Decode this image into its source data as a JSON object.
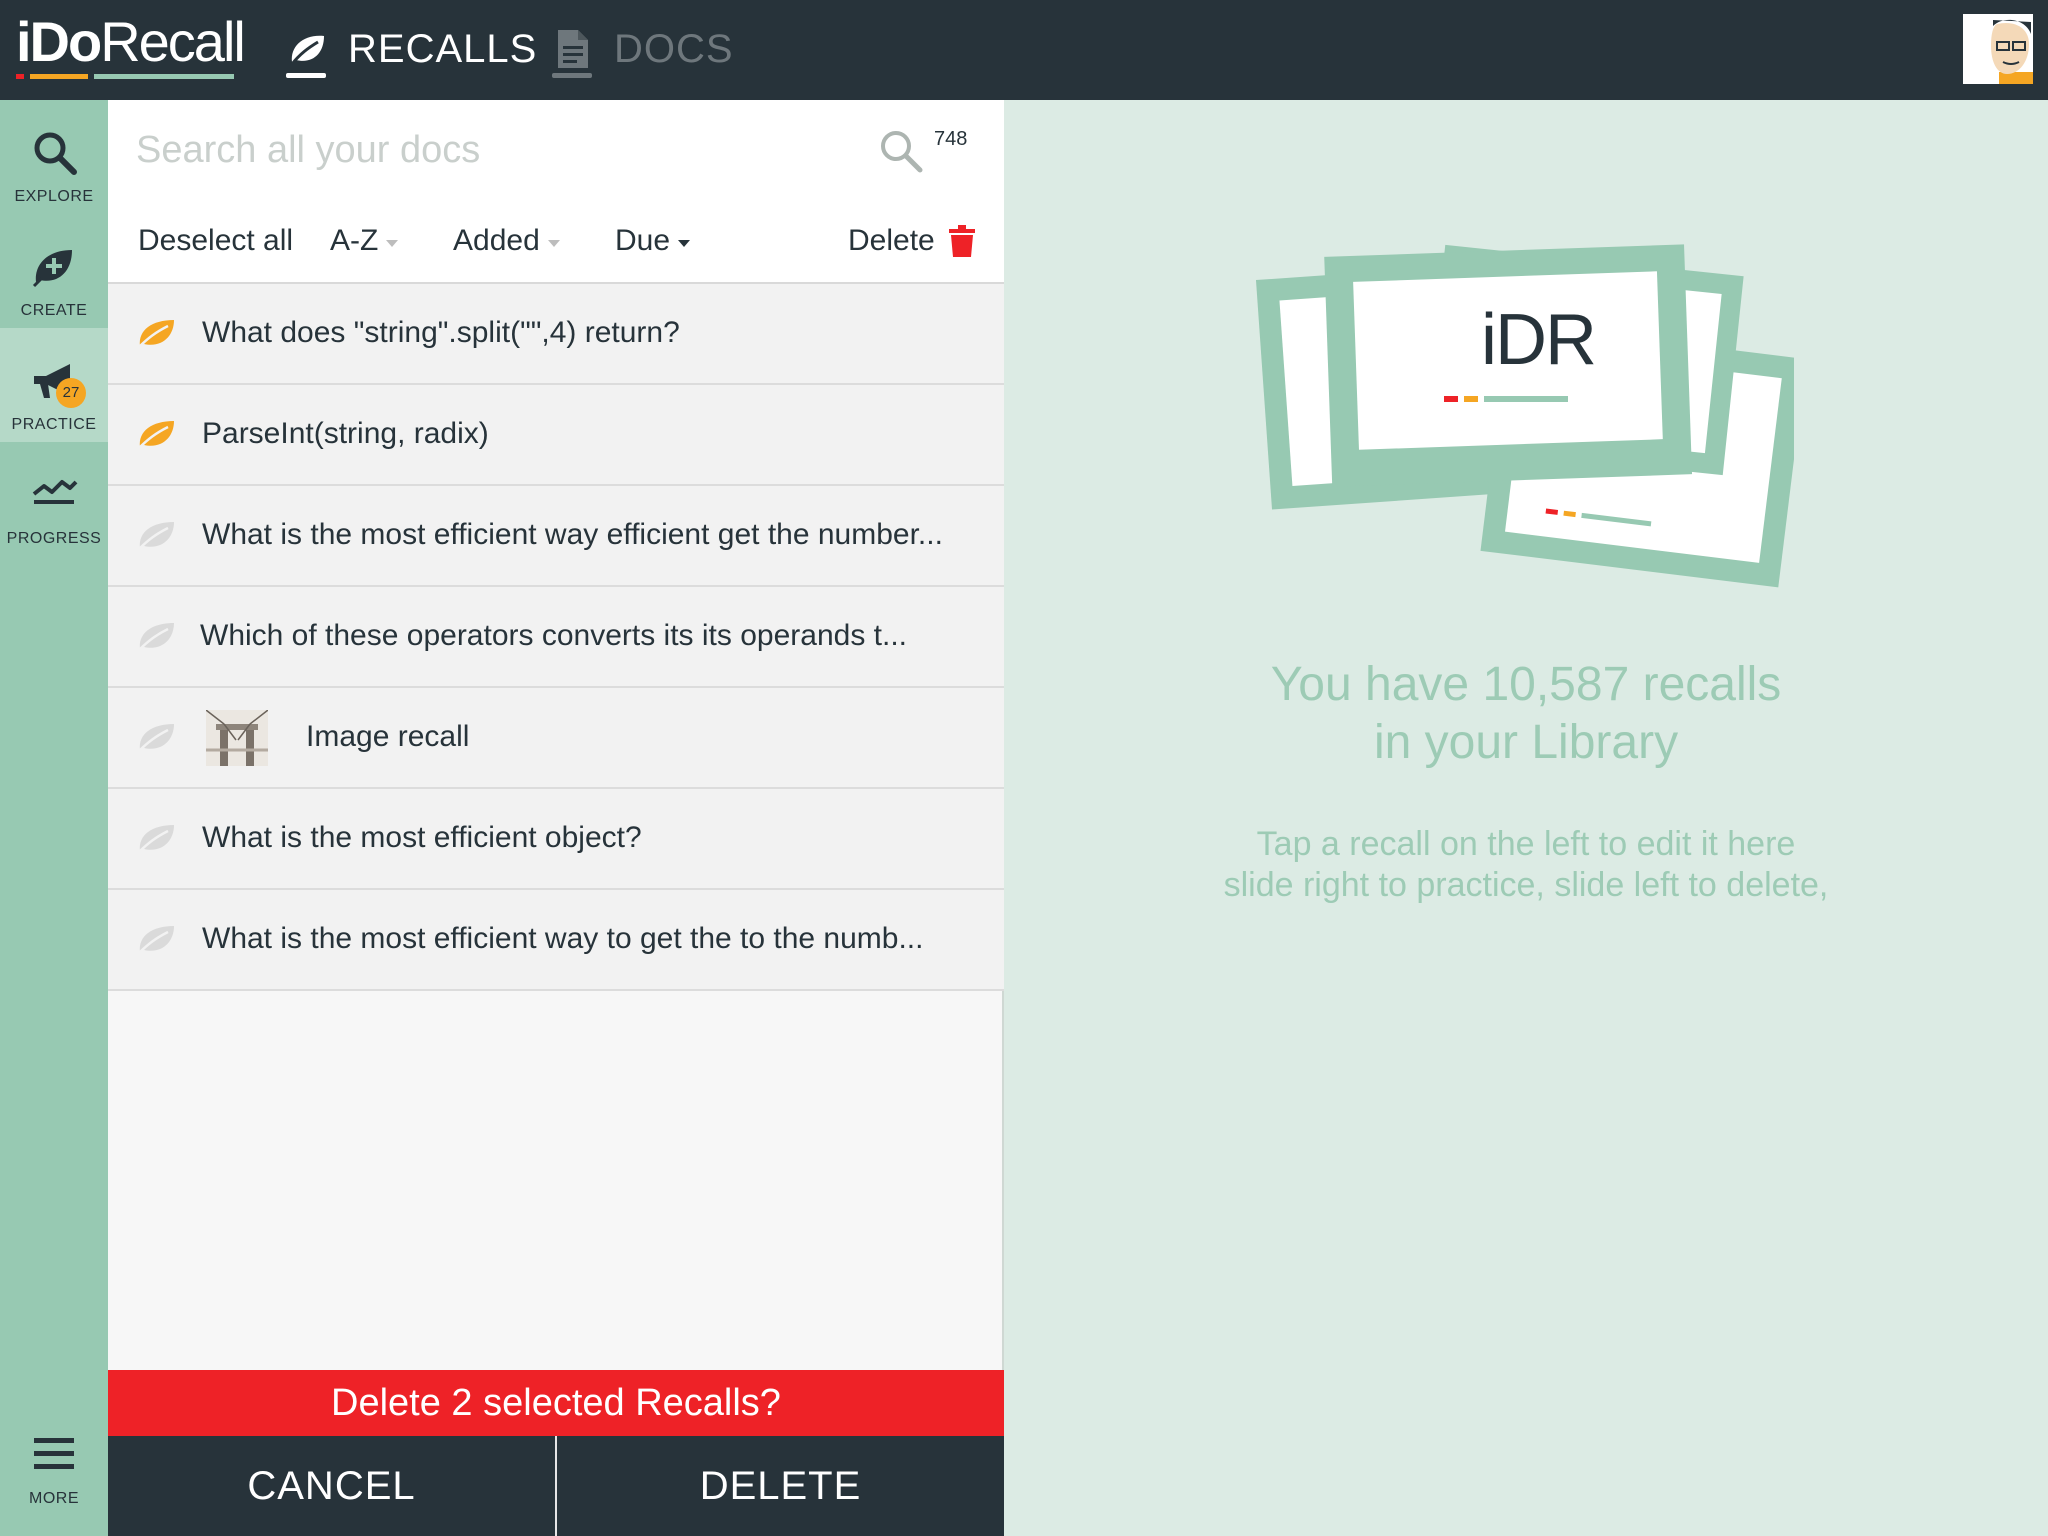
{
  "app": {
    "logo_primary": "iDo",
    "logo_secondary": "Recall",
    "brand_colors": {
      "dark": "#27333a",
      "mint": "#97c9b2",
      "orange": "#f5a623",
      "red": "#ee2227",
      "light_mint_bg": "#dcebe4"
    }
  },
  "nav": {
    "tabs": [
      {
        "label": "RECALLS",
        "icon": "leaf-icon",
        "active": true
      },
      {
        "label": "DOCS",
        "icon": "document-icon",
        "active": false
      }
    ],
    "avatar_icon": "user-avatar"
  },
  "sidebar": {
    "items": [
      {
        "label": "EXPLORE",
        "icon": "search-icon"
      },
      {
        "label": "CREATE",
        "icon": "add-leaf-icon"
      },
      {
        "label": "PRACTICE",
        "icon": "megaphone-icon",
        "badge": "27",
        "active": true
      },
      {
        "label": "PROGRESS",
        "icon": "trend-line-icon"
      }
    ],
    "more": {
      "label": "MORE",
      "icon": "hamburger-menu-icon"
    }
  },
  "search": {
    "placeholder": "Search all your docs",
    "value": "",
    "count": "748"
  },
  "toolbar": {
    "deselect_label": "Deselect all",
    "sort_az_label": "A-Z",
    "sort_added_label": "Added",
    "sort_due_label": "Due",
    "delete_label": "Delete"
  },
  "recalls": [
    {
      "text": "What does \"string\".split(\"\",4) return?",
      "selected": true
    },
    {
      "text": "ParseInt(string, radix)",
      "selected": true
    },
    {
      "text": "What is the most efficient way efficient get the number...",
      "selected": false
    },
    {
      "text": "Which of these operators converts its its operands t...",
      "selected": false
    },
    {
      "text": "Image recall",
      "selected": false,
      "has_image": true
    },
    {
      "text": "What is the most efficient object?",
      "selected": false
    },
    {
      "text": "What is the most efficient way to get the to  the numb...",
      "selected": false
    }
  ],
  "confirm": {
    "message": "Delete 2 selected Recalls?",
    "cancel_label": "CANCEL",
    "delete_label": "DELETE"
  },
  "empty_state": {
    "card_logo": "iDR",
    "title_line1": "You have 10,587 recalls",
    "title_line2": "in your Library",
    "hint_line1": "Tap a recall on the left to edit it here",
    "hint_line2": "slide right to practice, slide left to delete,"
  }
}
